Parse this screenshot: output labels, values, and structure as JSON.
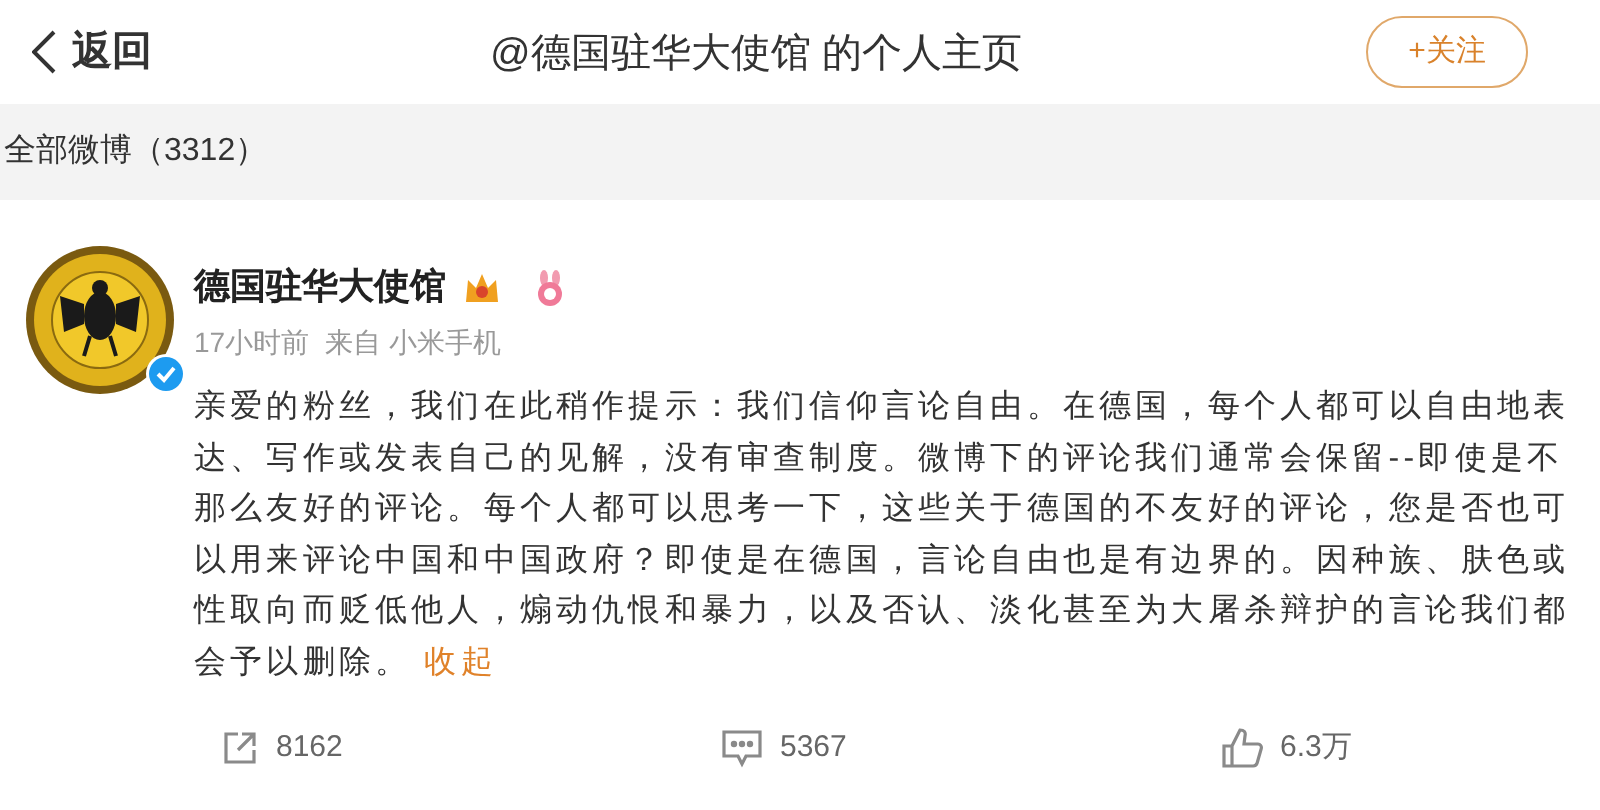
{
  "header": {
    "back_label": "返回",
    "title": "@德国驻华大使馆 的个人主页",
    "follow_button": "+关注"
  },
  "section": {
    "label": "全部微博（3312）"
  },
  "post": {
    "author": "德国驻华大使馆",
    "verified": true,
    "time": "17小时前",
    "source": "来自 小米手机",
    "text": "亲爱的粉丝，我们在此稍作提示：我们信仰言论自由。在德国，每个人都可以自由地表达、写作或发表自己的见解，没有审查制度。微博下的评论我们通常会保留--即使是不那么友好的评论。每个人都可以思考一下，这些关于德国的不友好的评论，您是否也可以用来评论中国和中国政府？即使是在德国，言论自由也是有边界的。因种族、肤色或性取向而贬低他人，煽动仇恨和暴力，以及否认、淡化甚至为大屠杀辩护的言论我们都会予以删除。",
    "collapse_link": "收起",
    "actions": [
      {
        "kind": "repost",
        "count": "8162"
      },
      {
        "kind": "comment",
        "count": "5367"
      },
      {
        "kind": "like",
        "count": "6.3万"
      }
    ]
  }
}
